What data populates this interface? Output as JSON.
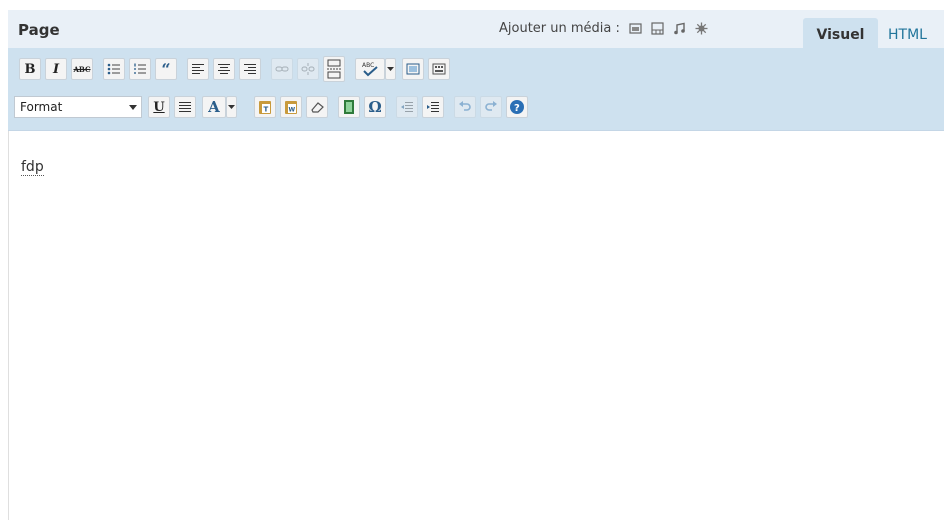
{
  "header": {
    "title": "Page",
    "add_media_label": "Ajouter un média :",
    "media_icons": [
      "image-icon",
      "gallery-icon",
      "audio-icon",
      "other-media-icon"
    ]
  },
  "tabs": [
    {
      "label": "Visuel",
      "active": true
    },
    {
      "label": "HTML",
      "active": false
    }
  ],
  "toolbar": {
    "row1": [
      "bold",
      "italic",
      "strikethrough",
      "bullet-list",
      "numbered-list",
      "blockquote",
      "align-left",
      "align-center",
      "align-right",
      "insert-link",
      "unlink",
      "more-tag",
      "spellcheck",
      "spellcheck-menu",
      "fullscreen",
      "kitchen-sink"
    ],
    "row2": [
      "format-select",
      "underline",
      "justify",
      "text-color",
      "text-color-menu",
      "paste-text",
      "paste-word",
      "remove-format",
      "insert-media",
      "special-character",
      "outdent",
      "indent",
      "undo",
      "redo",
      "help"
    ],
    "format_value": "Format",
    "labels": {
      "bold": "B",
      "italic": "I",
      "strike": "ABC",
      "underline": "U",
      "text_color": "A",
      "omega": "Ω",
      "quote": "“"
    }
  },
  "content": {
    "text": "fdp"
  },
  "colors": {
    "header_bg": "#e9f0f7",
    "toolbar_bg": "#cee1ef",
    "html_tab_text": "#21759b"
  }
}
